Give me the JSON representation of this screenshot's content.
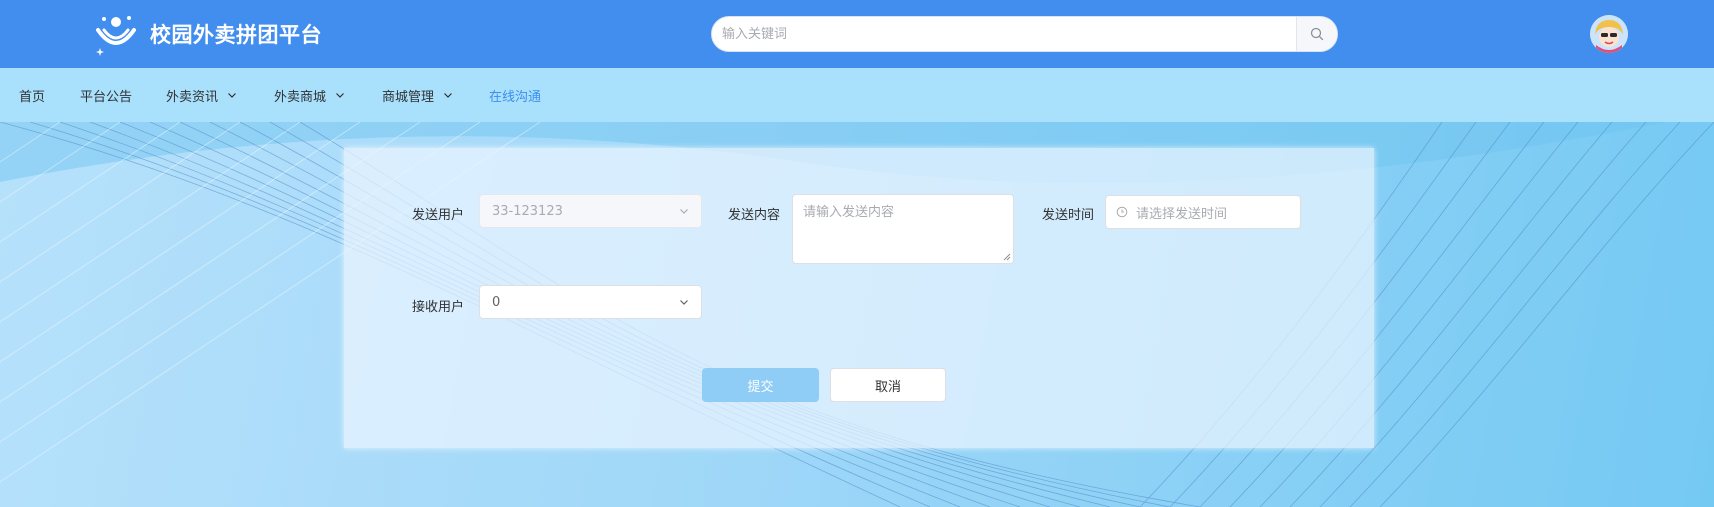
{
  "header": {
    "site_title": "校园外卖拼团平台",
    "search_placeholder": "输入关键词",
    "search_icon": "search-icon",
    "avatar_icon": "user-avatar",
    "brand_color": "#418eef"
  },
  "nav": {
    "items": [
      {
        "label": "首页",
        "has_dropdown": false
      },
      {
        "label": "平台公告",
        "has_dropdown": false
      },
      {
        "label": "外卖资讯",
        "has_dropdown": true
      },
      {
        "label": "外卖商城",
        "has_dropdown": true
      },
      {
        "label": "商城管理",
        "has_dropdown": true
      },
      {
        "label": "在线沟通",
        "has_dropdown": false,
        "active": true
      }
    ],
    "active_color": "#3c8ef0"
  },
  "form": {
    "sender_label": "发送用户",
    "sender_value": "33-123123",
    "content_label": "发送内容",
    "content_placeholder": "请输入发送内容",
    "time_label": "发送时间",
    "time_placeholder": "请选择发送时间",
    "receiver_label": "接收用户",
    "receiver_value": "0",
    "submit_label": "提交",
    "cancel_label": "取消"
  }
}
